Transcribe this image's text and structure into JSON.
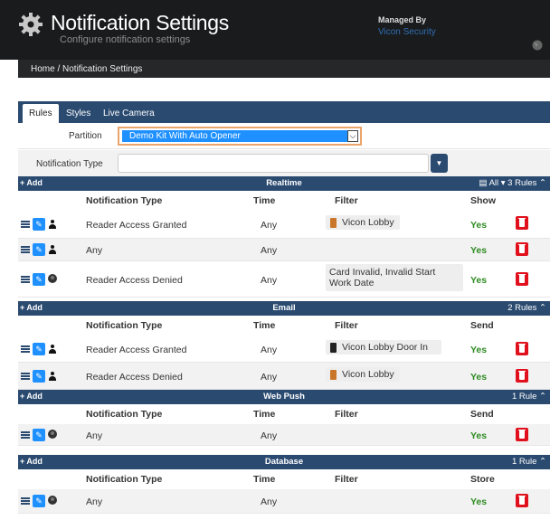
{
  "header": {
    "title": "Notification Settings",
    "subtitle": "Configure notification settings",
    "managed_label": "Managed By",
    "managed_value": "Vicon Security"
  },
  "breadcrumb": "Home / Notification Settings",
  "tabs": [
    {
      "label": "Rules"
    },
    {
      "label": "Styles"
    },
    {
      "label": "Live Camera"
    }
  ],
  "partition": {
    "label": "Partition",
    "value": "Demo Kit With Auto Opener"
  },
  "notification_type": {
    "label": "Notification Type",
    "value": ""
  },
  "add_label": "+ Add",
  "realtime": {
    "title": "Realtime",
    "right": "▤ All ▾  3 Rules ⌃",
    "cols": [
      "Notification Type",
      "Time",
      "Filter",
      "Show"
    ],
    "rows": [
      {
        "type": "Reader Access Granted",
        "time": "Any",
        "filter": "Vicon Lobby",
        "show": "Yes"
      },
      {
        "type": "Any",
        "time": "Any",
        "filter": "",
        "show": "Yes"
      },
      {
        "type": "Reader Access Denied",
        "time": "Any",
        "filter": "Card Invalid, Invalid Start Work Date",
        "show": "Yes"
      }
    ]
  },
  "email": {
    "title": "Email",
    "right": "2 Rules ⌃",
    "cols": [
      "Notification Type",
      "Time",
      "Filter",
      "Send"
    ],
    "rows": [
      {
        "type": "Reader Access Granted",
        "time": "Any",
        "filter": "Vicon Lobby Door In",
        "show": "Yes"
      },
      {
        "type": "Reader Access Denied",
        "time": "Any",
        "filter": "Vicon Lobby",
        "show": "Yes"
      }
    ]
  },
  "webpush": {
    "title": "Web Push",
    "right": "1 Rule ⌃",
    "cols": [
      "Notification Type",
      "Time",
      "Filter",
      "Send"
    ],
    "rows": [
      {
        "type": "Any",
        "time": "Any",
        "filter": "",
        "show": "Yes"
      }
    ]
  },
  "database": {
    "title": "Database",
    "right": "1 Rule ⌃",
    "cols": [
      "Notification Type",
      "Time",
      "Filter",
      "Store"
    ],
    "rows": [
      {
        "type": "Any",
        "time": "Any",
        "filter": "",
        "show": "Yes"
      }
    ]
  },
  "colors": {
    "header_bg": "#1a1b1c",
    "section_bar": "#2a4a70",
    "accent": "#1e90ff",
    "yes": "#2e8b22",
    "delete": "#e0101c"
  }
}
